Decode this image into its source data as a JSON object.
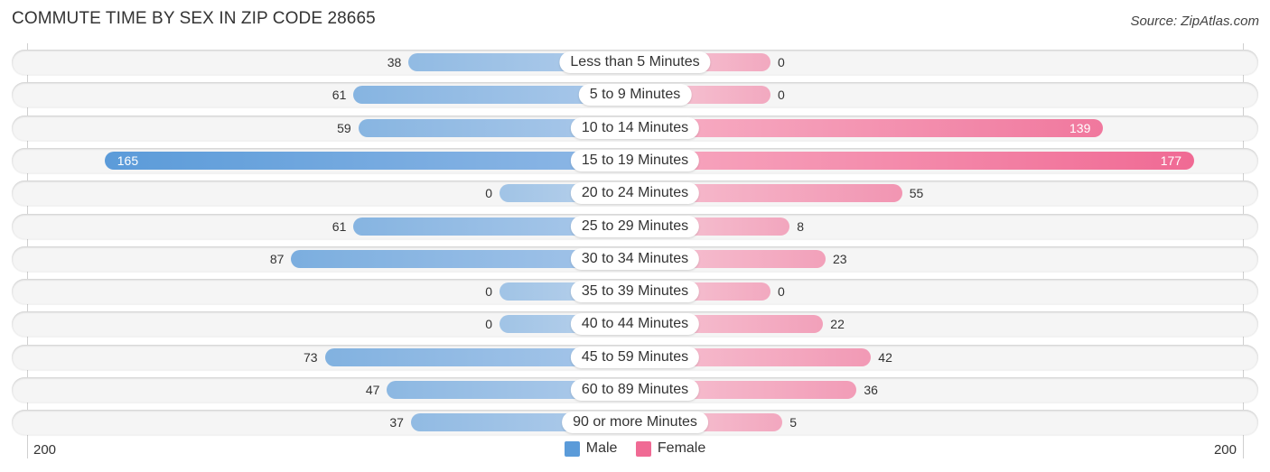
{
  "header": {
    "title": "COMMUTE TIME BY SEX IN ZIP CODE 28665",
    "source": "Source: ZipAtlas.com"
  },
  "chart_data": {
    "type": "bar",
    "orientation": "horizontal-diverging",
    "title": "COMMUTE TIME BY SEX IN ZIP CODE 28665",
    "categories": [
      "Less than 5 Minutes",
      "5 to 9 Minutes",
      "10 to 14 Minutes",
      "15 to 19 Minutes",
      "20 to 24 Minutes",
      "25 to 29 Minutes",
      "30 to 34 Minutes",
      "35 to 39 Minutes",
      "40 to 44 Minutes",
      "45 to 59 Minutes",
      "60 to 89 Minutes",
      "90 or more Minutes"
    ],
    "series": [
      {
        "name": "Male",
        "color": "#5b9bd9",
        "values": [
          38,
          61,
          59,
          165,
          0,
          61,
          87,
          0,
          0,
          73,
          47,
          37
        ]
      },
      {
        "name": "Female",
        "color": "#f06a94",
        "values": [
          0,
          0,
          139,
          177,
          55,
          8,
          23,
          0,
          22,
          42,
          36,
          5
        ]
      }
    ],
    "xlim": [
      -200,
      200
    ],
    "axis_tick_labels": {
      "left": "200",
      "right": "200"
    },
    "legend_position": "bottom-center",
    "grid": false
  },
  "legend": {
    "items": [
      {
        "label": "Male",
        "color": "#5b9bd9"
      },
      {
        "label": "Female",
        "color": "#f06a94"
      }
    ]
  }
}
